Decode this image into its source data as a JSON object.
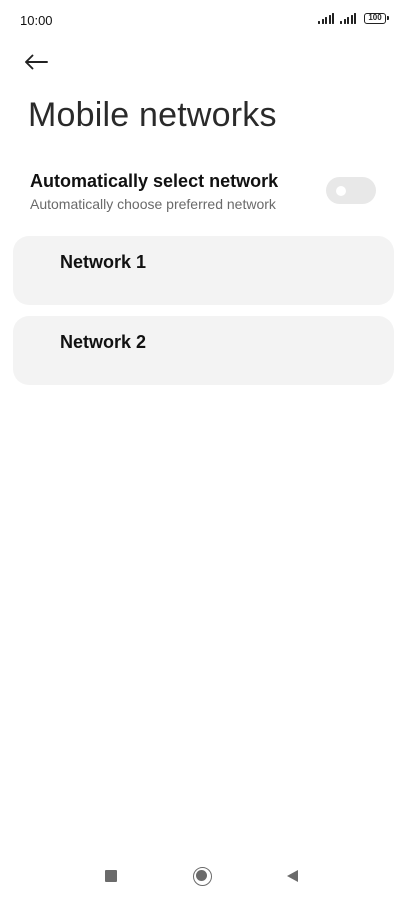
{
  "status_bar": {
    "time": "10:00",
    "battery_level": "100",
    "signal_icons": [
      "signal-strength-icon",
      "signal-strength-icon"
    ]
  },
  "header": {
    "back_icon": "arrow-left-icon",
    "title": "Mobile networks"
  },
  "auto_select": {
    "title": "Automatically select network",
    "subtitle": "Automatically choose preferred network",
    "enabled": false
  },
  "networks": [
    {
      "label": "Network 1"
    },
    {
      "label": "Network 2"
    }
  ],
  "nav_bar": {
    "icons": [
      "recents-square-icon",
      "home-circle-icon",
      "back-triangle-icon"
    ]
  },
  "colors": {
    "card_background": "#f3f3f3",
    "toggle_off": "#e8e8e8",
    "subtitle_text": "#6a6a6a",
    "nav_icon": "#6b6b6b"
  }
}
